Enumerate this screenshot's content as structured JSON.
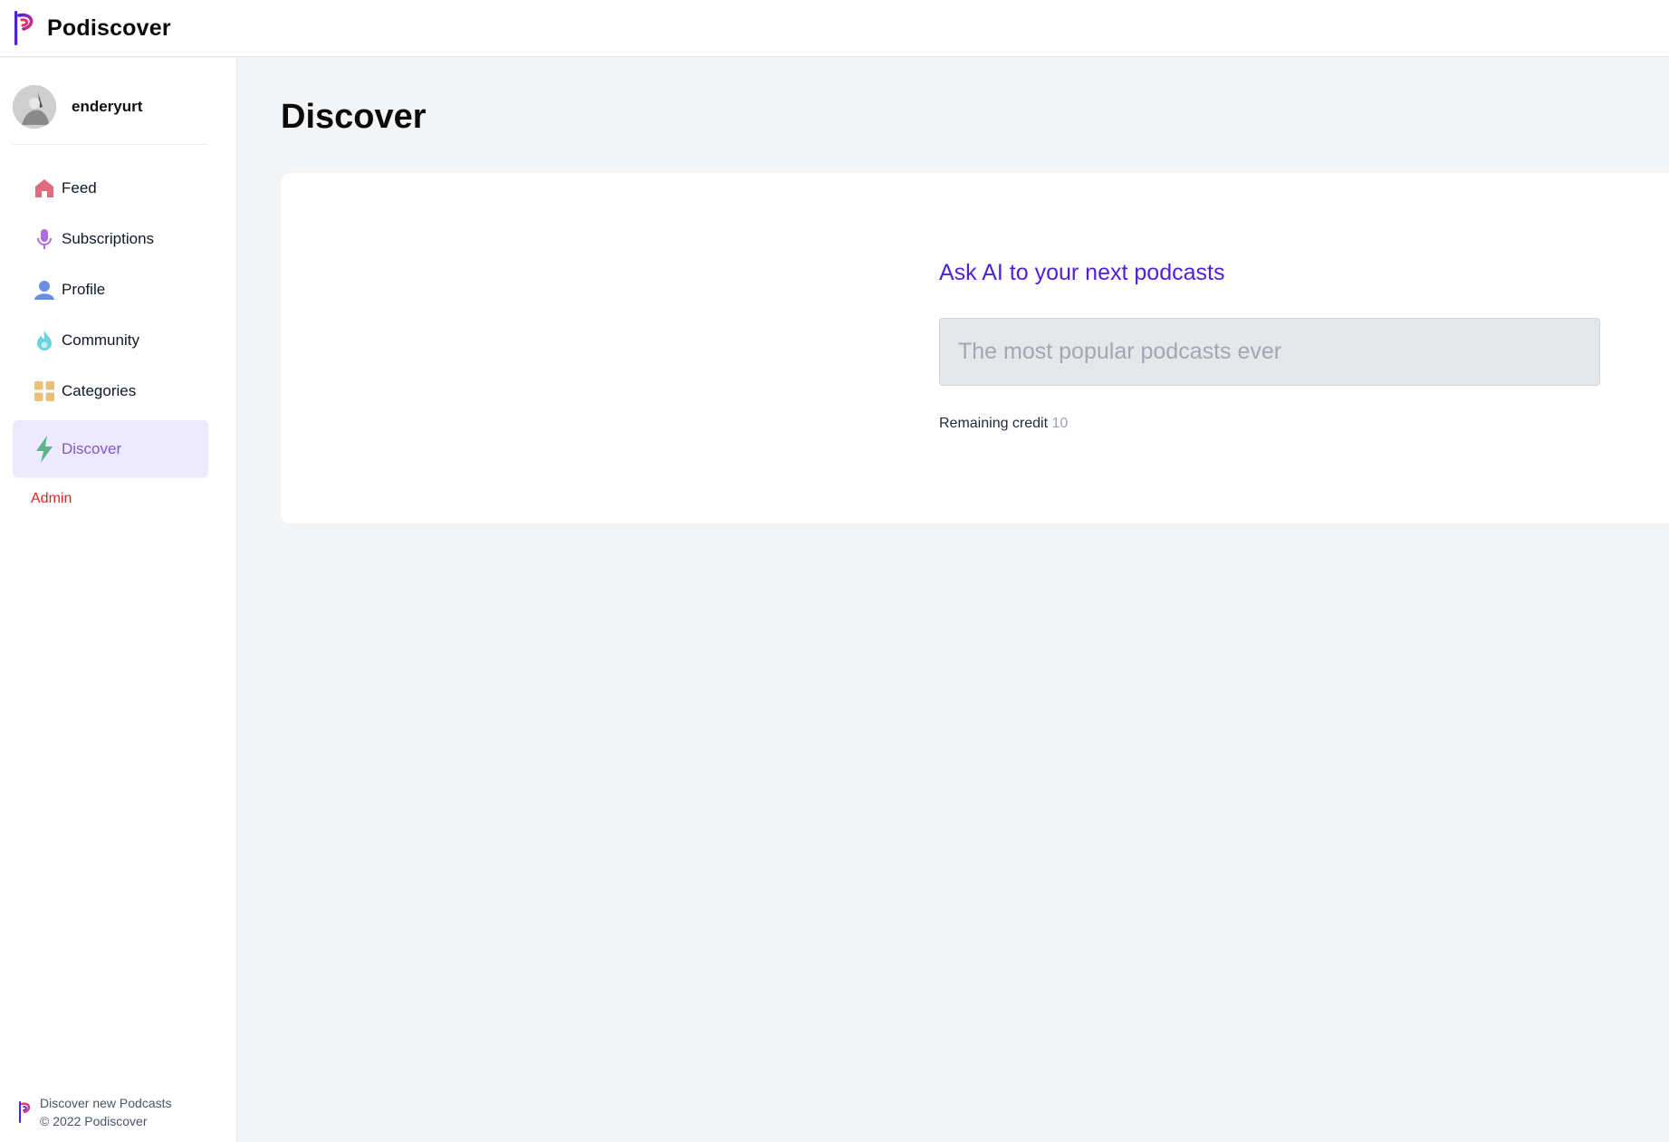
{
  "app": {
    "name": "Podiscover",
    "brand_colors": {
      "primary": "#4f1fdc",
      "accent": "#e0356b"
    }
  },
  "user": {
    "username": "enderyurt"
  },
  "sidebar": {
    "items": [
      {
        "label": "Feed",
        "icon": "home-icon",
        "color": "#e06b7f",
        "active": false
      },
      {
        "label": "Subscriptions",
        "icon": "microphone-icon",
        "color": "#b36be0",
        "active": false
      },
      {
        "label": "Profile",
        "icon": "user-icon",
        "color": "#6b8ee0",
        "active": false
      },
      {
        "label": "Community",
        "icon": "fire-icon",
        "color": "#6bd3e0",
        "active": false
      },
      {
        "label": "Categories",
        "icon": "grid-icon",
        "color": "#e8c07a",
        "active": false
      },
      {
        "label": "Discover",
        "icon": "lightning-icon",
        "color": "#5fb48a",
        "active": true
      }
    ],
    "admin_label": "Admin",
    "footer": {
      "line1": "Discover new Podcasts",
      "line2": "© 2022 Podiscover"
    }
  },
  "main": {
    "title": "Discover",
    "ask": {
      "heading": "Ask AI to your next podcasts",
      "input_value": "",
      "input_placeholder": "The most popular podcasts ever",
      "credit_label": "Remaining credit",
      "credit_value": "10"
    }
  }
}
